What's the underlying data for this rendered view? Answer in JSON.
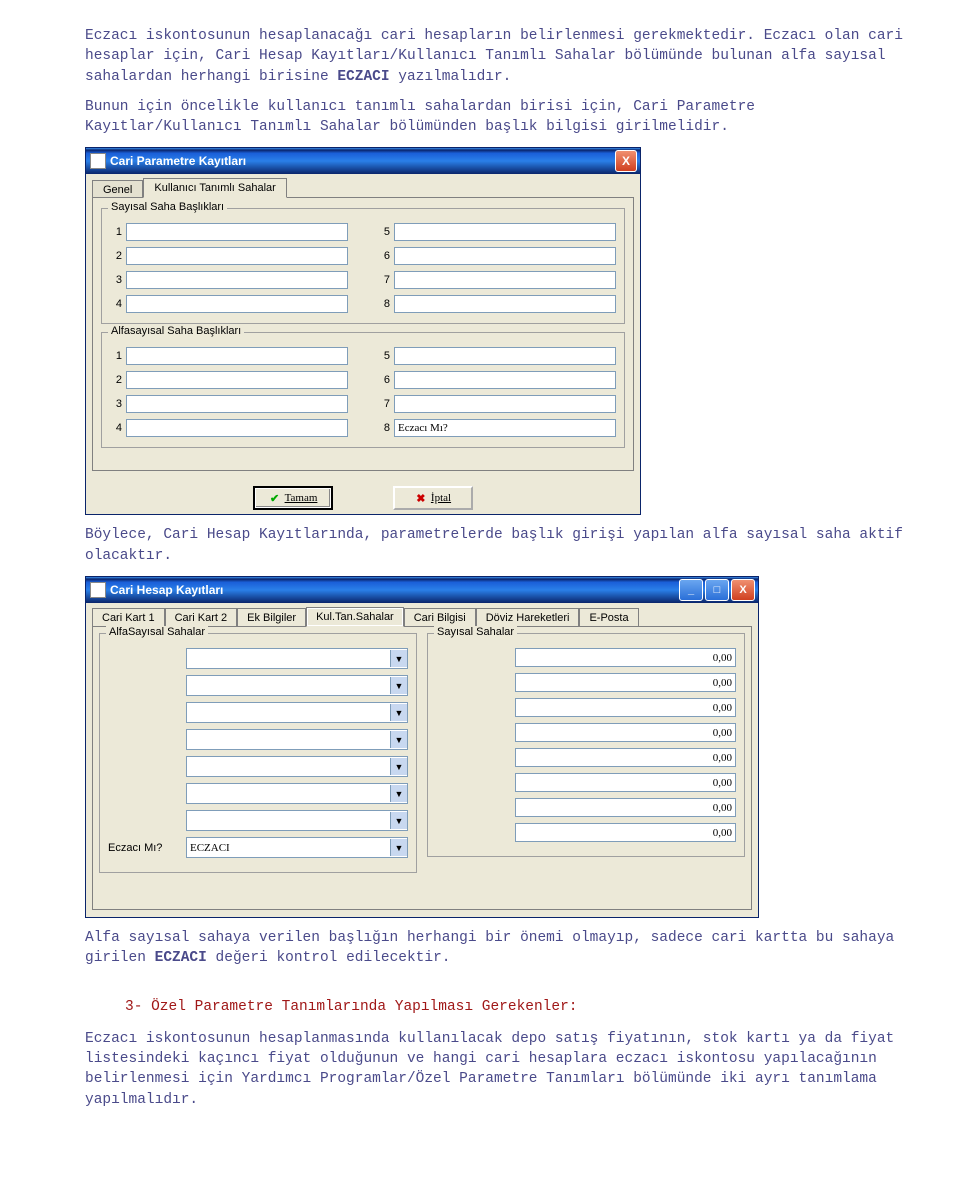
{
  "doc": {
    "p1": "Eczacı iskontosunun hesaplanacağı cari hesapların belirlenmesi gerekmektedir. Eczacı olan cari hesaplar için, Cari Hesap Kayıtları/Kullanıcı Tanımlı Sahalar bölümünde bulunan alfa sayısal sahalardan herhangi birisine ",
    "p1b": "ECZACI",
    "p1c": " yazılmalıdır.",
    "p2": "Bunun için öncelikle kullanıcı tanımlı sahalardan birisi için, Cari Parametre Kayıtlar/Kullanıcı Tanımlı Sahalar bölümünden başlık bilgisi girilmelidir.",
    "p3": "Böylece, Cari Hesap Kayıtlarında, parametrelerde başlık girişi yapılan alfa sayısal saha aktif olacaktır.",
    "p4": "Alfa sayısal sahaya verilen başlığın herhangi bir önemi olmayıp, sadece cari kartta bu sahaya girilen ",
    "p4b": "ECZACI",
    "p4c": " değeri kontrol edilecektir.",
    "section3": "3- Özel Parametre Tanımlarında Yapılması Gerekenler:",
    "p5": "Eczacı iskontosunun hesaplanmasında kullanılacak depo satış fiyatının, stok kartı ya da fiyat listesindeki kaçıncı fiyat olduğunun ve hangi cari hesaplara eczacı iskontosu yapılacağının belirlenmesi için Yardımcı Programlar/Özel Parametre Tanımları bölümünde iki ayrı tanımlama yapılmalıdır."
  },
  "win1": {
    "title": "Cari Parametre Kayıtları",
    "close": "X",
    "tabs": {
      "t0": "Genel",
      "t1": "Kullanıcı Tanımlı Sahalar"
    },
    "group1": "Sayısal Saha Başlıkları",
    "group2": "Alfasayısal Saha Başlıkları",
    "nums": {
      "n1": "1",
      "n2": "2",
      "n3": "3",
      "n4": "4",
      "n5": "5",
      "n6": "6",
      "n7": "7",
      "n8": "8"
    },
    "alfa8value": "Eczacı Mı?",
    "okbtn": "Tamam",
    "cancelbtn": "İptal"
  },
  "win2": {
    "title": "Cari Hesap Kayıtları",
    "tabs": {
      "t0": "Cari Kart 1",
      "t1": "Cari Kart 2",
      "t2": "Ek Bilgiler",
      "t3": "Kul.Tan.Sahalar",
      "t4": "Cari Bilgisi",
      "t5": "Döviz Hareketleri",
      "t6": "E-Posta"
    },
    "groupA": "AlfaSayısal Sahalar",
    "groupB": "Sayısal Sahalar",
    "rowlabel": "Eczacı Mı?",
    "rowvalue": "ECZACI",
    "zero": "0,00",
    "min": "_",
    "max": "□",
    "close": "X",
    "dd": "▼"
  }
}
